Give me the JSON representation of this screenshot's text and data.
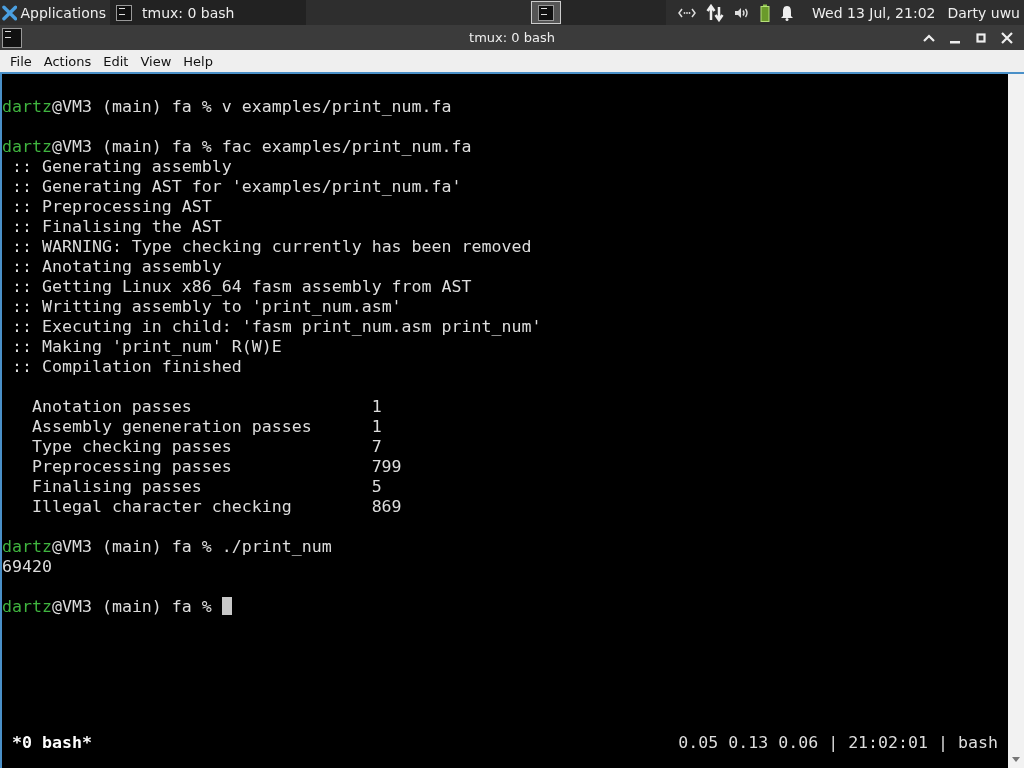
{
  "panel": {
    "apps_label": "Applications",
    "task": {
      "title": "tmux: 0 bash",
      "selected": true
    },
    "clock": "Wed 13 Jul, 21:02",
    "user": "Darty uwu"
  },
  "window": {
    "title": "tmux: 0 bash"
  },
  "menu": [
    "File",
    "Actions",
    "Edit",
    "View",
    "Help"
  ],
  "terminal": {
    "lines": [
      {
        "kind": "blank"
      },
      {
        "kind": "prompt",
        "user": "dartz",
        "rest": "@VM3 (main) fa % v examples/print_num.fa",
        "cursor": false
      },
      {
        "kind": "blank"
      },
      {
        "kind": "prompt",
        "user": "dartz",
        "rest": "@VM3 (main) fa % fac examples/print_num.fa",
        "cursor": false
      },
      {
        "kind": "output",
        "text": " :: Generating assembly"
      },
      {
        "kind": "output",
        "text": " :: Generating AST for 'examples/print_num.fa'"
      },
      {
        "kind": "output",
        "text": " :: Preprocessing AST"
      },
      {
        "kind": "output",
        "text": " :: Finalising the AST"
      },
      {
        "kind": "output",
        "text": " :: WARNING: Type checking currently has been removed"
      },
      {
        "kind": "output",
        "text": " :: Anotating assembly"
      },
      {
        "kind": "output",
        "text": " :: Getting Linux x86_64 fasm assembly from AST"
      },
      {
        "kind": "output",
        "text": " :: Writting assembly to 'print_num.asm'"
      },
      {
        "kind": "output",
        "text": " :: Executing in child: 'fasm print_num.asm print_num'"
      },
      {
        "kind": "output",
        "text": " :: Making 'print_num' R(W)E"
      },
      {
        "kind": "output",
        "text": " :: Compilation finished"
      },
      {
        "kind": "blank"
      },
      {
        "kind": "stat",
        "label": "Anotation passes",
        "value": "1"
      },
      {
        "kind": "stat",
        "label": "Assembly geneneration passes",
        "value": "1"
      },
      {
        "kind": "stat",
        "label": "Type checking passes",
        "value": "7"
      },
      {
        "kind": "stat",
        "label": "Preprocessing passes",
        "value": "799"
      },
      {
        "kind": "stat",
        "label": "Finalising passes",
        "value": "5"
      },
      {
        "kind": "stat",
        "label": "Illegal character checking",
        "value": "869"
      },
      {
        "kind": "blank"
      },
      {
        "kind": "prompt",
        "user": "dartz",
        "rest": "@VM3 (main) fa % ./print_num",
        "cursor": false
      },
      {
        "kind": "output",
        "text": "69420"
      },
      {
        "kind": "blank"
      },
      {
        "kind": "prompt",
        "user": "dartz",
        "rest": "@VM3 (main) fa % ",
        "cursor": true
      }
    ]
  },
  "tmux_status": {
    "window": "*0 bash*",
    "info": "0.05 0.13 0.06 | 21:02:01 | bash"
  }
}
